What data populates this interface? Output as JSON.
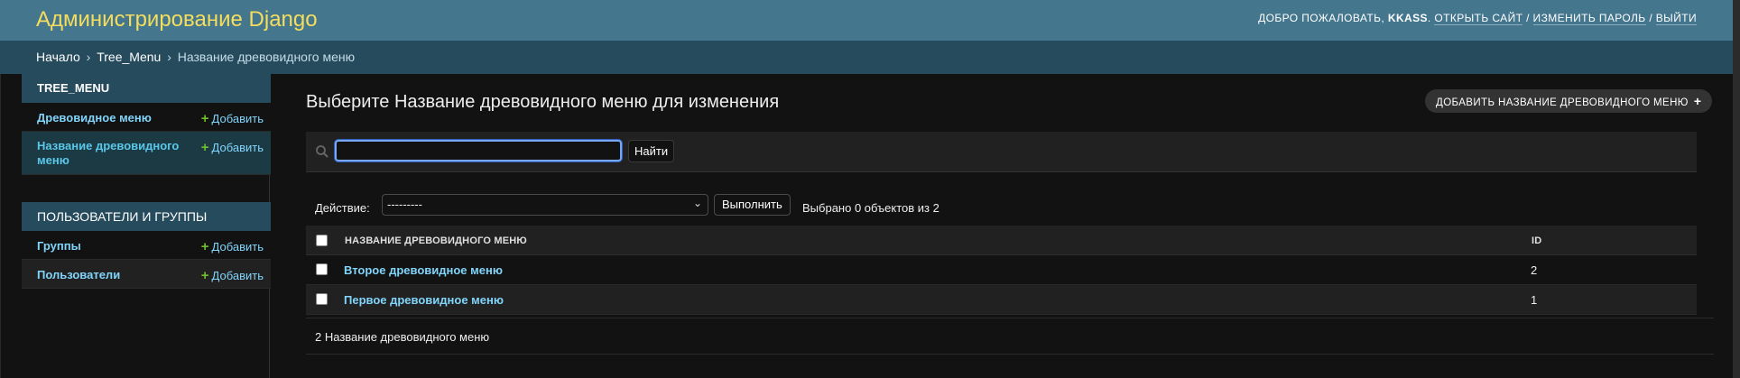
{
  "header": {
    "brand": "Администрирование Django",
    "welcome": "Добро пожаловать,",
    "username": "KKASS",
    "view_site": "Открыть сайт",
    "change_password": "Изменить пароль",
    "logout": "Выйти",
    "separator": "/"
  },
  "breadcrumbs": {
    "home": "Начало",
    "app": "Tree_Menu",
    "current": "Название древовидного меню",
    "sep": "›"
  },
  "sidebar": {
    "modules": [
      {
        "caption": "TREE_MENU",
        "items": [
          {
            "label": "Древовидное меню",
            "add": "Добавить"
          },
          {
            "label": "Название древовидного меню",
            "add": "Добавить"
          }
        ]
      },
      {
        "caption": "ПОЛЬЗОВАТЕЛИ И ГРУППЫ",
        "items": [
          {
            "label": "Группы",
            "add": "Добавить"
          },
          {
            "label": "Пользователи",
            "add": "Добавить"
          }
        ]
      }
    ]
  },
  "main": {
    "title": "Выберите Название древовидного меню для изменения",
    "add_button": "Добавить Название древовидного меню",
    "add_icon": "+",
    "search": {
      "value": "",
      "button": "Найти"
    },
    "actions": {
      "label": "Действие:",
      "selected": "---------",
      "go": "Выполнить",
      "counter": "Выбрано 0 объектов из 2"
    },
    "table": {
      "columns": [
        "Название древовидного меню",
        "ID"
      ],
      "rows": [
        {
          "name": "Второе древовидное меню",
          "id": "2"
        },
        {
          "name": "Первое древовидное меню",
          "id": "1"
        }
      ]
    },
    "paginator": "2 Название древовидного меню"
  },
  "colors": {
    "header_bg": "#44768e",
    "brand": "#f5dd5d",
    "breadcrumbs_bg": "#264b5d",
    "link": "#81d4fa",
    "add_green": "#70bf2b"
  }
}
